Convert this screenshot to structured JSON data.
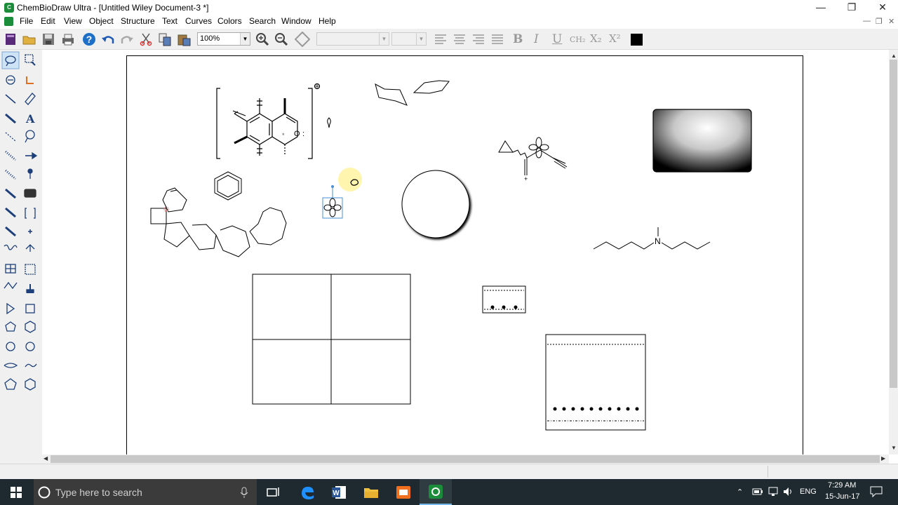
{
  "window": {
    "title": "ChemBioDraw Ultra - [Untitled Wiley Document-3 *]"
  },
  "menu": [
    "File",
    "Edit",
    "View",
    "Object",
    "Structure",
    "Text",
    "Curves",
    "Colors",
    "Search",
    "Window",
    "Help"
  ],
  "toolbar": {
    "zoom_value": "100%",
    "font_value": "",
    "size_value": ""
  },
  "format": {
    "bold": "B",
    "italic": "I",
    "underline": "U",
    "formula": "CH₂",
    "subscript": "X₂",
    "superscript": "X²"
  },
  "canvas": {
    "n_label": "N",
    "o_label": "O",
    "colon": ":",
    "charge": "⊕",
    "plus": "+",
    "star": "*"
  },
  "taskbar": {
    "search_placeholder": "Type here to search",
    "lang": "ENG",
    "time": "7:29 AM",
    "date": "15-Jun-17"
  },
  "icons": [
    "new-icon",
    "open-icon",
    "save-icon",
    "print-icon",
    "help-icon",
    "undo-icon",
    "redo-icon",
    "cut-icon",
    "copy-icon",
    "paste-icon",
    "zoom-in-icon",
    "zoom-out-icon",
    "fit-icon"
  ],
  "colors": {
    "accent": "#76b9ed",
    "taskbar": "#1e2a2f"
  }
}
